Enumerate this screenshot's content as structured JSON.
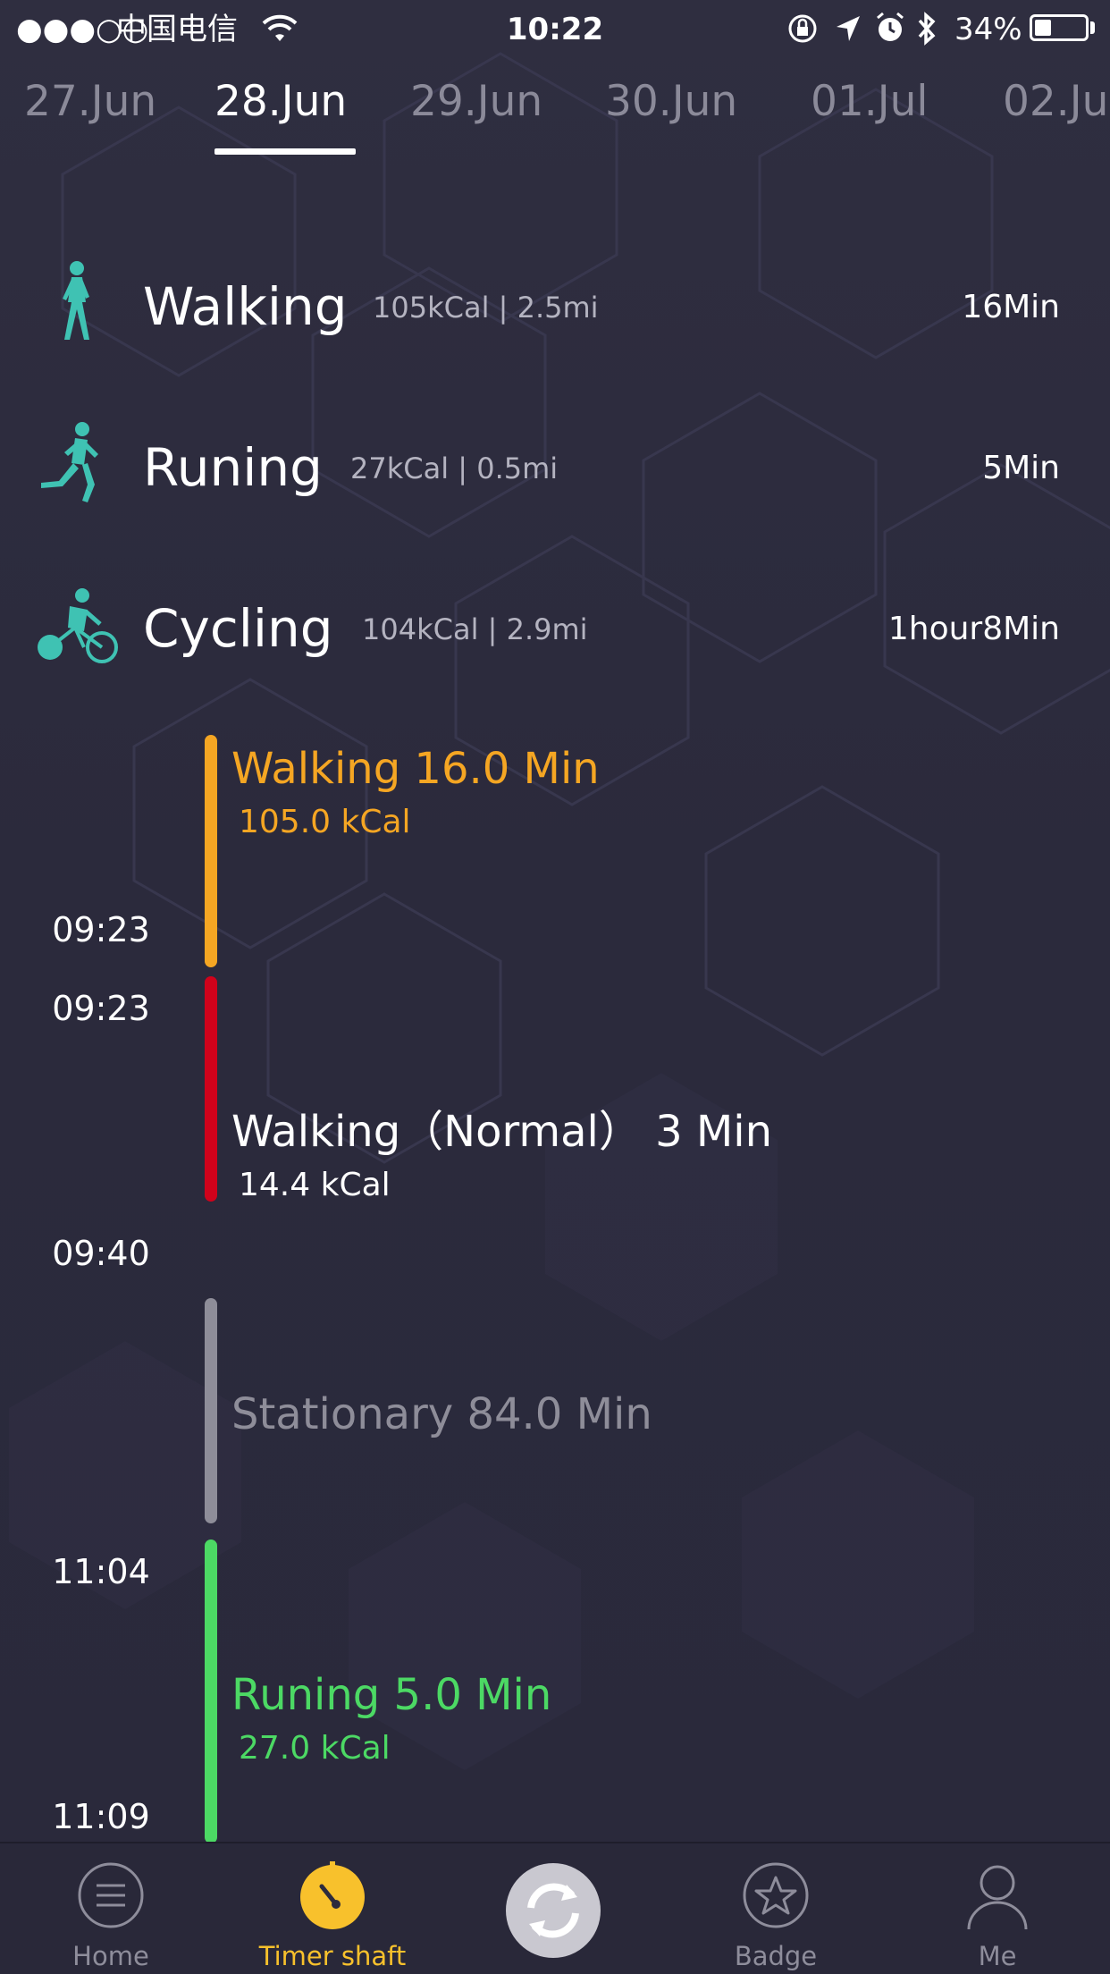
{
  "status_bar": {
    "signal": "●●●○○",
    "carrier": "中国电信",
    "time": "10:22",
    "battery": "34%",
    "battery_level": 0.34
  },
  "date_tabs": [
    {
      "label": "27.Jun",
      "active": false
    },
    {
      "label": "28.Jun",
      "active": true
    },
    {
      "label": "29.Jun",
      "active": false
    },
    {
      "label": "30.Jun",
      "active": false
    },
    {
      "label": "01.Jul",
      "active": false
    },
    {
      "label": "02.Ju",
      "active": false
    }
  ],
  "summary": [
    {
      "name": "Walking",
      "stats": "105kCal | 2.5mi",
      "duration": "16Min",
      "icon": "walking-icon"
    },
    {
      "name": "Runing",
      "stats": "27kCal | 0.5mi",
      "duration": "5Min",
      "icon": "running-icon"
    },
    {
      "name": "Cycling",
      "stats": "104kCal | 2.9mi",
      "duration": "1hour8Min",
      "icon": "cycling-icon"
    }
  ],
  "timeline": [
    {
      "title": "Walking 16.0 Min",
      "kcal": "105.0 kCal",
      "start": "",
      "end": "09:23",
      "color": "#f5a623"
    },
    {
      "title": "Walking（Normal） 3 Min",
      "kcal": "14.4 kCal",
      "start": "09:23",
      "end": "09:40",
      "color": "#d0021b"
    },
    {
      "title": "Stationary 84.0 Min",
      "kcal": "",
      "start": "",
      "end": "",
      "color": "#8e8d99"
    },
    {
      "title": "Runing 5.0 Min",
      "kcal": "27.0 kCal",
      "start": "11:04",
      "end": "11:09",
      "color": "#4cd964"
    }
  ],
  "tab_bar": {
    "items": [
      {
        "label": "Home",
        "icon": "menu-icon",
        "active": false
      },
      {
        "label": "Timer shaft",
        "icon": "timer-icon",
        "active": true
      },
      {
        "label": "",
        "icon": "sync-icon",
        "active": false
      },
      {
        "label": "Badge",
        "icon": "star-badge-icon",
        "active": false
      },
      {
        "label": "Me",
        "icon": "person-icon",
        "active": false
      }
    ]
  },
  "colors": {
    "background": "#2c2b3d",
    "accent_teal": "#3fc2b3",
    "active_tab": "#f8c12c",
    "walking": "#f5a623",
    "normal_walking": "#d0021b",
    "stationary": "#8e8d99",
    "running": "#4cd964"
  }
}
